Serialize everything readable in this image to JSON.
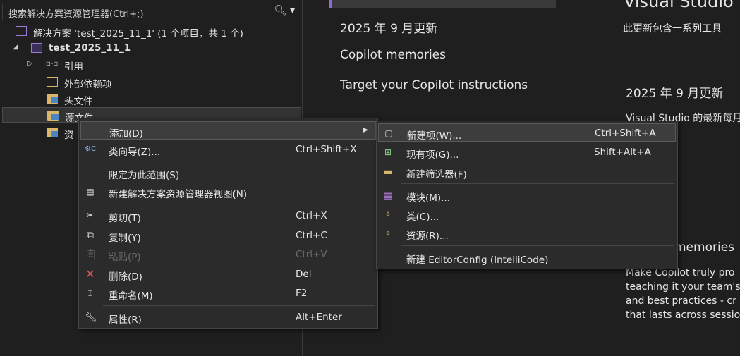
{
  "solution_explorer": {
    "search_placeholder": "搜索解决方案资源管理器(Ctrl+;)",
    "search_icon": "search-icon",
    "items": [
      {
        "label": "解决方案 'test_2025_11_1' (1 个项目，共 1 个)",
        "icon": "solution-icon"
      },
      {
        "label": "test_2025_11_1",
        "icon": "project-icon"
      },
      {
        "label": "引用",
        "icon": "references-icon"
      },
      {
        "label": "外部依赖项",
        "icon": "external-deps-icon"
      },
      {
        "label": "头文件",
        "icon": "folder-icon"
      },
      {
        "label": "源文件",
        "icon": "folder-icon"
      },
      {
        "label": "资",
        "icon": "folder-icon"
      }
    ]
  },
  "right_pane": {
    "nav": [
      "2025 年 9 月更新",
      "Copilot memories",
      "Target your Copilot instructions"
    ],
    "heading": "Visual Studio",
    "intro": "此更新包含一系列工具",
    "section_title": "2025 年 9 月更新",
    "section_text": "Visual Studio 的最新每月",
    "memories_title": "memories",
    "memories_lines": [
      "Make Copilot truly pro",
      "teaching it your team's",
      "and best practices - cr",
      "that lasts across sessio"
    ]
  },
  "context_menu": {
    "items": [
      {
        "label": "添加(D)",
        "shortcut": "",
        "icon": "",
        "submenu": true
      },
      {
        "label": "类向导(Z)...",
        "shortcut": "Ctrl+Shift+X",
        "icon": "class-wizard-icon"
      },
      {
        "label": "限定为此范围(S)",
        "shortcut": "",
        "icon": ""
      },
      {
        "label": "新建解决方案资源管理器视图(N)",
        "shortcut": "",
        "icon": "new-view-icon"
      },
      {
        "label": "剪切(T)",
        "shortcut": "Ctrl+X",
        "icon": "cut-icon"
      },
      {
        "label": "复制(Y)",
        "shortcut": "Ctrl+C",
        "icon": "copy-icon"
      },
      {
        "label": "粘贴(P)",
        "shortcut": "Ctrl+V",
        "icon": "paste-icon",
        "disabled": true
      },
      {
        "label": "删除(D)",
        "shortcut": "Del",
        "icon": "delete-icon"
      },
      {
        "label": "重命名(M)",
        "shortcut": "F2",
        "icon": "rename-icon"
      },
      {
        "label": "属性(R)",
        "shortcut": "Alt+Enter",
        "icon": "properties-icon"
      }
    ]
  },
  "submenu": {
    "items": [
      {
        "label": "新建项(W)...",
        "shortcut": "Ctrl+Shift+A",
        "icon": "new-item-icon"
      },
      {
        "label": "现有项(G)...",
        "shortcut": "Shift+Alt+A",
        "icon": "existing-item-icon"
      },
      {
        "label": "新建筛选器(F)",
        "shortcut": "",
        "icon": "new-filter-icon"
      },
      {
        "label": "模块(M)...",
        "shortcut": "",
        "icon": "module-icon"
      },
      {
        "label": "类(C)...",
        "shortcut": "",
        "icon": "class-icon"
      },
      {
        "label": "资源(R)...",
        "shortcut": "",
        "icon": "resource-icon"
      },
      {
        "label": "新建 EditorConfig (IntelliCode)",
        "shortcut": "",
        "icon": ""
      }
    ]
  },
  "colors": {
    "accent": "#8a6fd1",
    "bg": "#1f1f1f",
    "menu_bg": "#2b2b2b"
  }
}
